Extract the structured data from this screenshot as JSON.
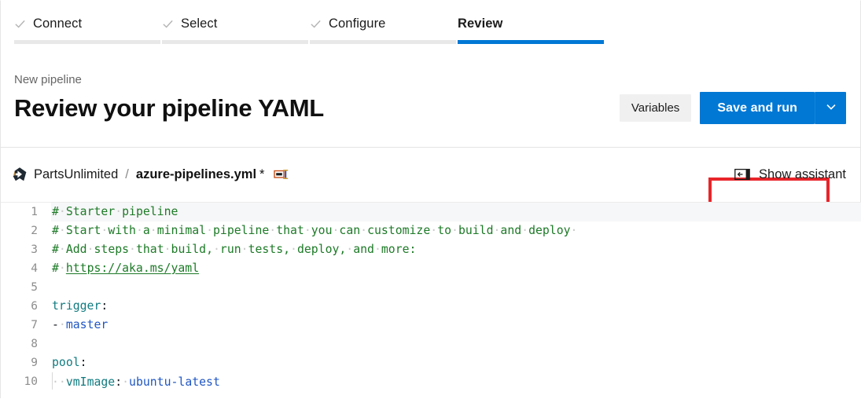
{
  "wizard": {
    "tabs": [
      {
        "label": "Connect",
        "state": "done",
        "icon": "check-icon"
      },
      {
        "label": "Select",
        "state": "done",
        "icon": "check-icon"
      },
      {
        "label": "Configure",
        "state": "done",
        "icon": "check-icon"
      },
      {
        "label": "Review",
        "state": "active",
        "icon": ""
      }
    ]
  },
  "header": {
    "breadcrumb": "New pipeline",
    "title": "Review your pipeline YAML",
    "variables_label": "Variables",
    "save_and_run_label": "Save and run",
    "caret_icon": "chevron-down-icon",
    "accent_color": "#0078d4",
    "highlight_color": "#e8252a"
  },
  "file_bar": {
    "repo_icon": "azure-repos-icon",
    "repo_name": "PartsUnlimited",
    "separator": "/",
    "file_name": "azure-pipelines.yml",
    "dirty_marker": "*",
    "rename_icon": "rename-file-icon",
    "assistant_icon": "show-panel-icon",
    "assistant_label": "Show assistant"
  },
  "editor": {
    "lines": [
      {
        "number": "1",
        "current": true,
        "tokens": [
          {
            "t": "comment",
            "v": "#"
          },
          {
            "t": "ws",
            "v": "·"
          },
          {
            "t": "comment",
            "v": "Starter"
          },
          {
            "t": "ws",
            "v": "·"
          },
          {
            "t": "comment",
            "v": "pipeline"
          }
        ]
      },
      {
        "number": "2",
        "current": false,
        "tokens": [
          {
            "t": "comment",
            "v": "#"
          },
          {
            "t": "ws",
            "v": "·"
          },
          {
            "t": "comment",
            "v": "Start"
          },
          {
            "t": "ws",
            "v": "·"
          },
          {
            "t": "comment",
            "v": "with"
          },
          {
            "t": "ws",
            "v": "·"
          },
          {
            "t": "comment",
            "v": "a"
          },
          {
            "t": "ws",
            "v": "·"
          },
          {
            "t": "comment",
            "v": "minimal"
          },
          {
            "t": "ws",
            "v": "·"
          },
          {
            "t": "comment",
            "v": "pipeline"
          },
          {
            "t": "ws",
            "v": "·"
          },
          {
            "t": "comment",
            "v": "that"
          },
          {
            "t": "ws",
            "v": "·"
          },
          {
            "t": "comment",
            "v": "you"
          },
          {
            "t": "ws",
            "v": "·"
          },
          {
            "t": "comment",
            "v": "can"
          },
          {
            "t": "ws",
            "v": "·"
          },
          {
            "t": "comment",
            "v": "customize"
          },
          {
            "t": "ws",
            "v": "·"
          },
          {
            "t": "comment",
            "v": "to"
          },
          {
            "t": "ws",
            "v": "·"
          },
          {
            "t": "comment",
            "v": "build"
          },
          {
            "t": "ws",
            "v": "·"
          },
          {
            "t": "comment",
            "v": "and"
          },
          {
            "t": "ws",
            "v": "·"
          },
          {
            "t": "comment",
            "v": "deploy"
          },
          {
            "t": "ws",
            "v": "·"
          }
        ]
      },
      {
        "number": "3",
        "current": false,
        "tokens": [
          {
            "t": "comment",
            "v": "#"
          },
          {
            "t": "ws",
            "v": "·"
          },
          {
            "t": "comment",
            "v": "Add"
          },
          {
            "t": "ws",
            "v": "·"
          },
          {
            "t": "comment",
            "v": "steps"
          },
          {
            "t": "ws",
            "v": "·"
          },
          {
            "t": "comment",
            "v": "that"
          },
          {
            "t": "ws",
            "v": "·"
          },
          {
            "t": "comment",
            "v": "build,"
          },
          {
            "t": "ws",
            "v": "·"
          },
          {
            "t": "comment",
            "v": "run"
          },
          {
            "t": "ws",
            "v": "·"
          },
          {
            "t": "comment",
            "v": "tests,"
          },
          {
            "t": "ws",
            "v": "·"
          },
          {
            "t": "comment",
            "v": "deploy,"
          },
          {
            "t": "ws",
            "v": "·"
          },
          {
            "t": "comment",
            "v": "and"
          },
          {
            "t": "ws",
            "v": "·"
          },
          {
            "t": "comment",
            "v": "more:"
          }
        ]
      },
      {
        "number": "4",
        "current": false,
        "tokens": [
          {
            "t": "comment",
            "v": "#"
          },
          {
            "t": "ws",
            "v": "·"
          },
          {
            "t": "link",
            "v": "https://aka.ms/yaml"
          }
        ]
      },
      {
        "number": "5",
        "current": false,
        "tokens": []
      },
      {
        "number": "6",
        "current": false,
        "tokens": [
          {
            "t": "key",
            "v": "trigger"
          },
          {
            "t": "punc",
            "v": ":"
          }
        ]
      },
      {
        "number": "7",
        "current": false,
        "tokens": [
          {
            "t": "dash",
            "v": "-"
          },
          {
            "t": "ws",
            "v": "·"
          },
          {
            "t": "value",
            "v": "master"
          }
        ]
      },
      {
        "number": "8",
        "current": false,
        "tokens": []
      },
      {
        "number": "9",
        "current": false,
        "tokens": [
          {
            "t": "key",
            "v": "pool"
          },
          {
            "t": "punc",
            "v": ":"
          }
        ]
      },
      {
        "number": "10",
        "current": false,
        "tokens": [
          {
            "t": "guide",
            "v": ""
          },
          {
            "t": "ws",
            "v": "·"
          },
          {
            "t": "ws",
            "v": "·"
          },
          {
            "t": "key",
            "v": "vmImage"
          },
          {
            "t": "punc",
            "v": ":"
          },
          {
            "t": "ws",
            "v": "·"
          },
          {
            "t": "value",
            "v": "ubuntu-latest"
          }
        ]
      }
    ]
  }
}
